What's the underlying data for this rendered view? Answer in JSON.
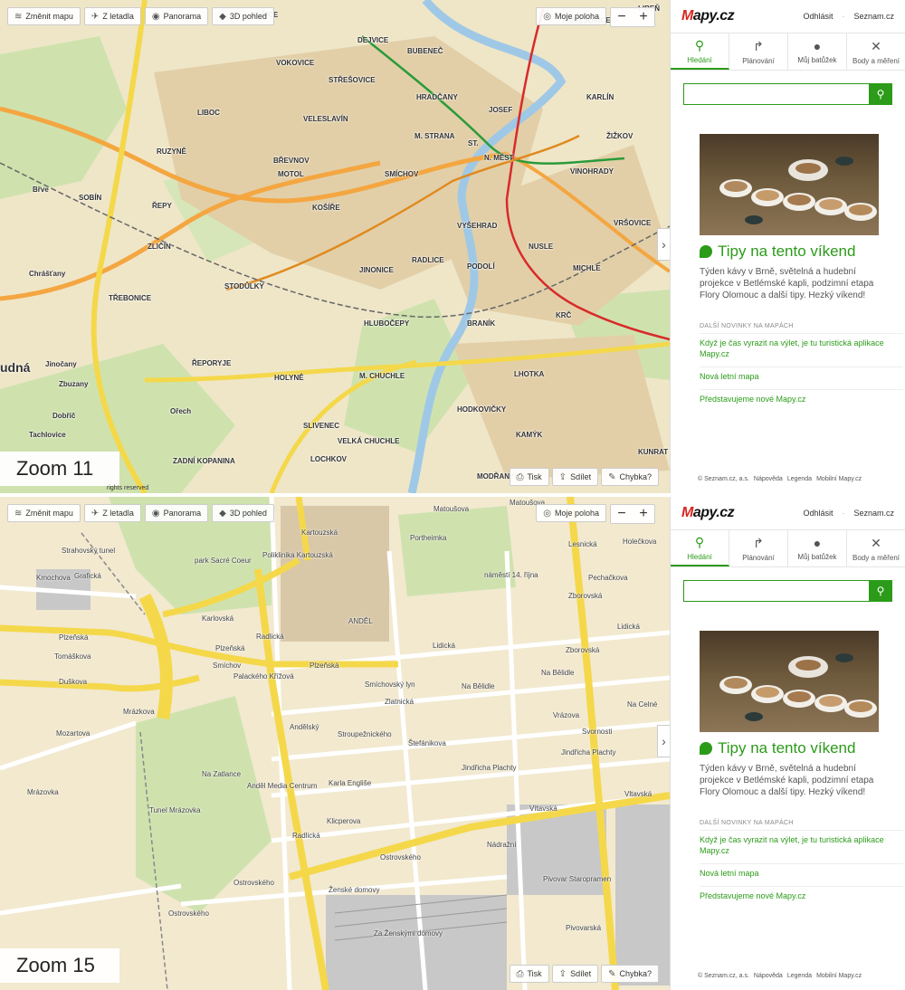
{
  "toolbar": {
    "change_map": "Změnit mapu",
    "aerial": "Z letadla",
    "panorama": "Panorama",
    "view3d": "3D pohled",
    "my_location": "Moje poloha",
    "zoom_out": "−",
    "zoom_in": "+",
    "collapse": "›"
  },
  "bottom_tools": {
    "print": "Tisk",
    "share": "Sdílet",
    "error": "Chybka?"
  },
  "copyright": "rights reserved",
  "panel": {
    "logo_m": "M",
    "logo_rest": "apy.cz",
    "logout": "Odhlásit",
    "seznam": "Seznam.cz",
    "tabs": [
      {
        "label": "Hledání",
        "icon": "search-icon"
      },
      {
        "label": "Plánování",
        "icon": "route-icon"
      },
      {
        "label": "Můj batůžek",
        "icon": "backpack-icon"
      },
      {
        "label": "Body a měření",
        "icon": "tools-icon"
      }
    ],
    "search_value": "",
    "promo_title": "Tipy na tento víkend",
    "promo_text": "Týden kávy v Brně, světelná a hudební projekce v Betlémské kapli, podzimní etapa Flory Olomouc a další tipy. Hezký víkend!",
    "news_heading": "DALŠÍ NOVINKY NA MAPÁCH",
    "news": [
      "Když je čas vyrazit na výlet, je tu turistická aplikace Mapy.cz",
      "Nová letní mapa",
      "Představujeme nové Mapy.cz"
    ],
    "footer": [
      "© Seznam.cz, a.s.",
      "Nápověda",
      "Legenda",
      "Mobilní Mapy.cz"
    ]
  },
  "top": {
    "zoom_label": "Zoom 11",
    "labels": [
      "BUŠICE",
      "DEJVICE",
      "BUBENEČ",
      "HOLEŠOVICE",
      "LIBEŇ",
      "VOKOVICE",
      "STŘEŠOVICE",
      "HRADČANY",
      "LIBOC",
      "VELESLAVÍN",
      "JOSEF",
      "KARLÍN",
      "M. STRANA",
      "ŽIŽKOV",
      "RUZYNĚ",
      "ST.",
      "N. MĚST",
      "BŘEVNOV",
      "VINOHRADY",
      "MOTOL",
      "SMÍCHOV",
      "SOBÍN",
      "ŘEPY",
      "KOŠÍŘE",
      "VYŠEHRAD",
      "VRŠOVICE",
      "ZLIČÍN",
      "NUSLE",
      "Chrášťany",
      "JINONICE",
      "RADLICE",
      "PODOLÍ",
      "MICHLE",
      "STODŮLKY",
      "TŘEBONICE",
      "KRČ",
      "HLUBOČEPY",
      "BRANÍK",
      "udná",
      "ŘEPORYJE",
      "Jinočany",
      "HOLYNĚ",
      "M. CHUCHLE",
      "LHOTKA",
      "Zbuzany",
      "Ořech",
      "HODKOVIČKY",
      "Dobříč",
      "SLIVENEC",
      "Tachlovice",
      "VELKÁ CHUCHLE",
      "KAMÝK",
      "ZADNÍ KOPANINA",
      "LOCHKOV",
      "KUNRAT",
      "MODŘANY",
      "Břve"
    ]
  },
  "bottom": {
    "zoom_label": "Zoom 15",
    "labels": [
      "Matoušova",
      "Kartouzská",
      "Poliklinika Kartouzská",
      "Matoušova",
      "Holečkova",
      "Strahovský tunel",
      "park Sacré Coeur",
      "Portheimka",
      "náměstí 14. října",
      "Lesnická",
      "Grafická",
      "Kmochova",
      "Zborovská",
      "Pechačkova",
      "Karlovská",
      "Plzeňská",
      "ANDĚL",
      "Lidická",
      "Tomáškova",
      "Radlická",
      "Lidická",
      "Na Bělidle",
      "Duškova",
      "Plzeňská",
      "Plzeňská",
      "Na Bělidle",
      "Mrázkova",
      "Smíchovský lyn",
      "Vrázova",
      "Zlatnická",
      "Mozartova",
      "Palackého Křížová",
      "Na Celné",
      "Smíchov",
      "Andělský",
      "Stroupežnického",
      "Svornosti",
      "Štefánikova",
      "Jindřicha Plachty",
      "Jindřicha Plachty",
      "Mrázovka",
      "Karla Engliše",
      "Vítavská",
      "Klicperova",
      "Vltavská",
      "Anděl Media Centrum",
      "Tunel Mrázovka",
      "Ostrovského",
      "Ostrovského",
      "Ostrovského",
      "Zborovská",
      "Za Ženskými domovy",
      "Pivovarská",
      "Pivovar Staropramen",
      "Ženské domovy",
      "Radlická",
      "Nádražní",
      "Na Zatlance"
    ]
  }
}
